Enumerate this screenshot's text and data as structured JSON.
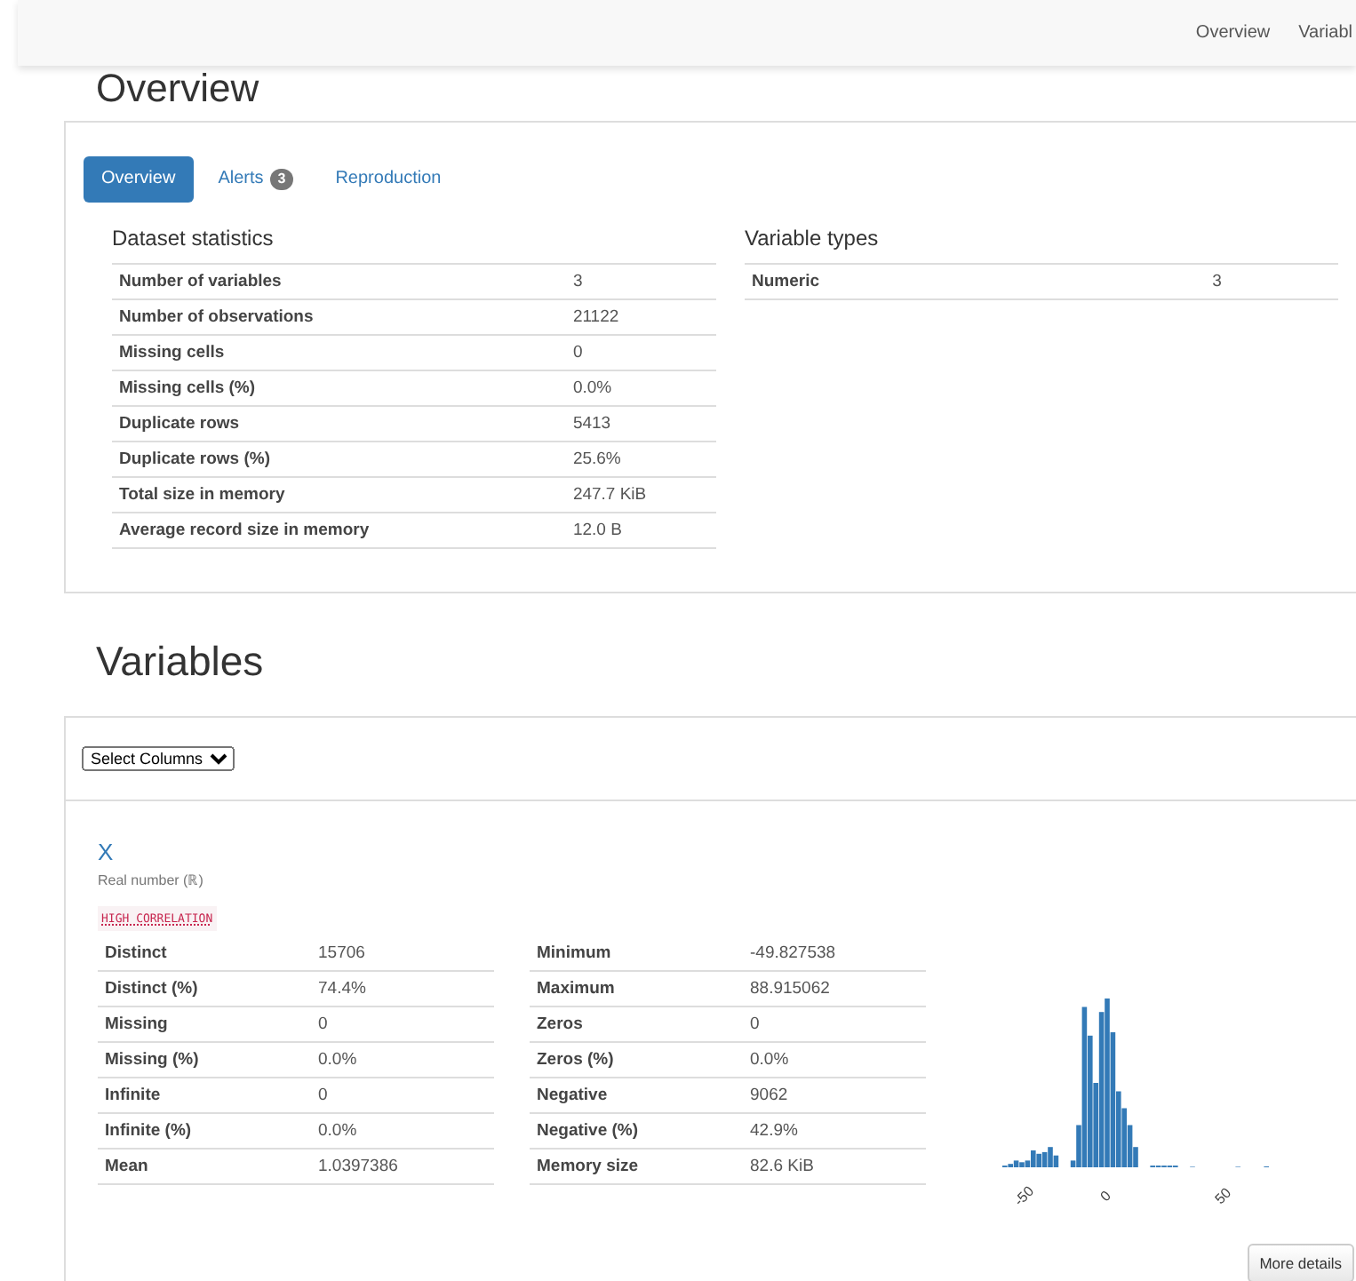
{
  "navbar": {
    "links": [
      {
        "label": "Overview"
      },
      {
        "label": "Variabl"
      }
    ]
  },
  "overview": {
    "heading": "Overview",
    "tabs": [
      {
        "label": "Overview",
        "selected": true
      },
      {
        "label": "Alerts",
        "badge": "3",
        "selected": false
      },
      {
        "label": "Reproduction",
        "selected": false
      }
    ],
    "dataset_statistics": {
      "title": "Dataset statistics",
      "rows": [
        {
          "label": "Number of variables",
          "value": "3"
        },
        {
          "label": "Number of observations",
          "value": "21122"
        },
        {
          "label": "Missing cells",
          "value": "0"
        },
        {
          "label": "Missing cells (%)",
          "value": "0.0%"
        },
        {
          "label": "Duplicate rows",
          "value": "5413"
        },
        {
          "label": "Duplicate rows (%)",
          "value": "25.6%"
        },
        {
          "label": "Total size in memory",
          "value": "247.7 KiB"
        },
        {
          "label": "Average record size in memory",
          "value": "12.0 B"
        }
      ]
    },
    "variable_types": {
      "title": "Variable types",
      "rows": [
        {
          "label": "Numeric",
          "value": "3"
        }
      ]
    }
  },
  "variables": {
    "heading": "Variables",
    "select": {
      "value": "Select Columns"
    },
    "variable": {
      "name": "X",
      "type": "Real number (ℝ)",
      "alerts": [
        "HIGH CORRELATION"
      ],
      "stats_left": [
        {
          "label": "Distinct",
          "value": "15706"
        },
        {
          "label": "Distinct (%)",
          "value": "74.4%"
        },
        {
          "label": "Missing",
          "value": "0"
        },
        {
          "label": "Missing (%)",
          "value": "0.0%"
        },
        {
          "label": "Infinite",
          "value": "0"
        },
        {
          "label": "Infinite (%)",
          "value": "0.0%"
        },
        {
          "label": "Mean",
          "value": "1.0397386"
        }
      ],
      "stats_right": [
        {
          "label": "Minimum",
          "value": "-49.827538"
        },
        {
          "label": "Maximum",
          "value": "88.915062"
        },
        {
          "label": "Zeros",
          "value": "0"
        },
        {
          "label": "Zeros (%)",
          "value": "0.0%"
        },
        {
          "label": "Negative",
          "value": "9062"
        },
        {
          "label": "Negative (%)",
          "value": "42.9%"
        },
        {
          "label": "Memory size",
          "value": "82.6 KiB"
        }
      ],
      "histogram_ticks": [
        "-50",
        "0",
        "50"
      ],
      "more_details": "More details"
    }
  }
}
